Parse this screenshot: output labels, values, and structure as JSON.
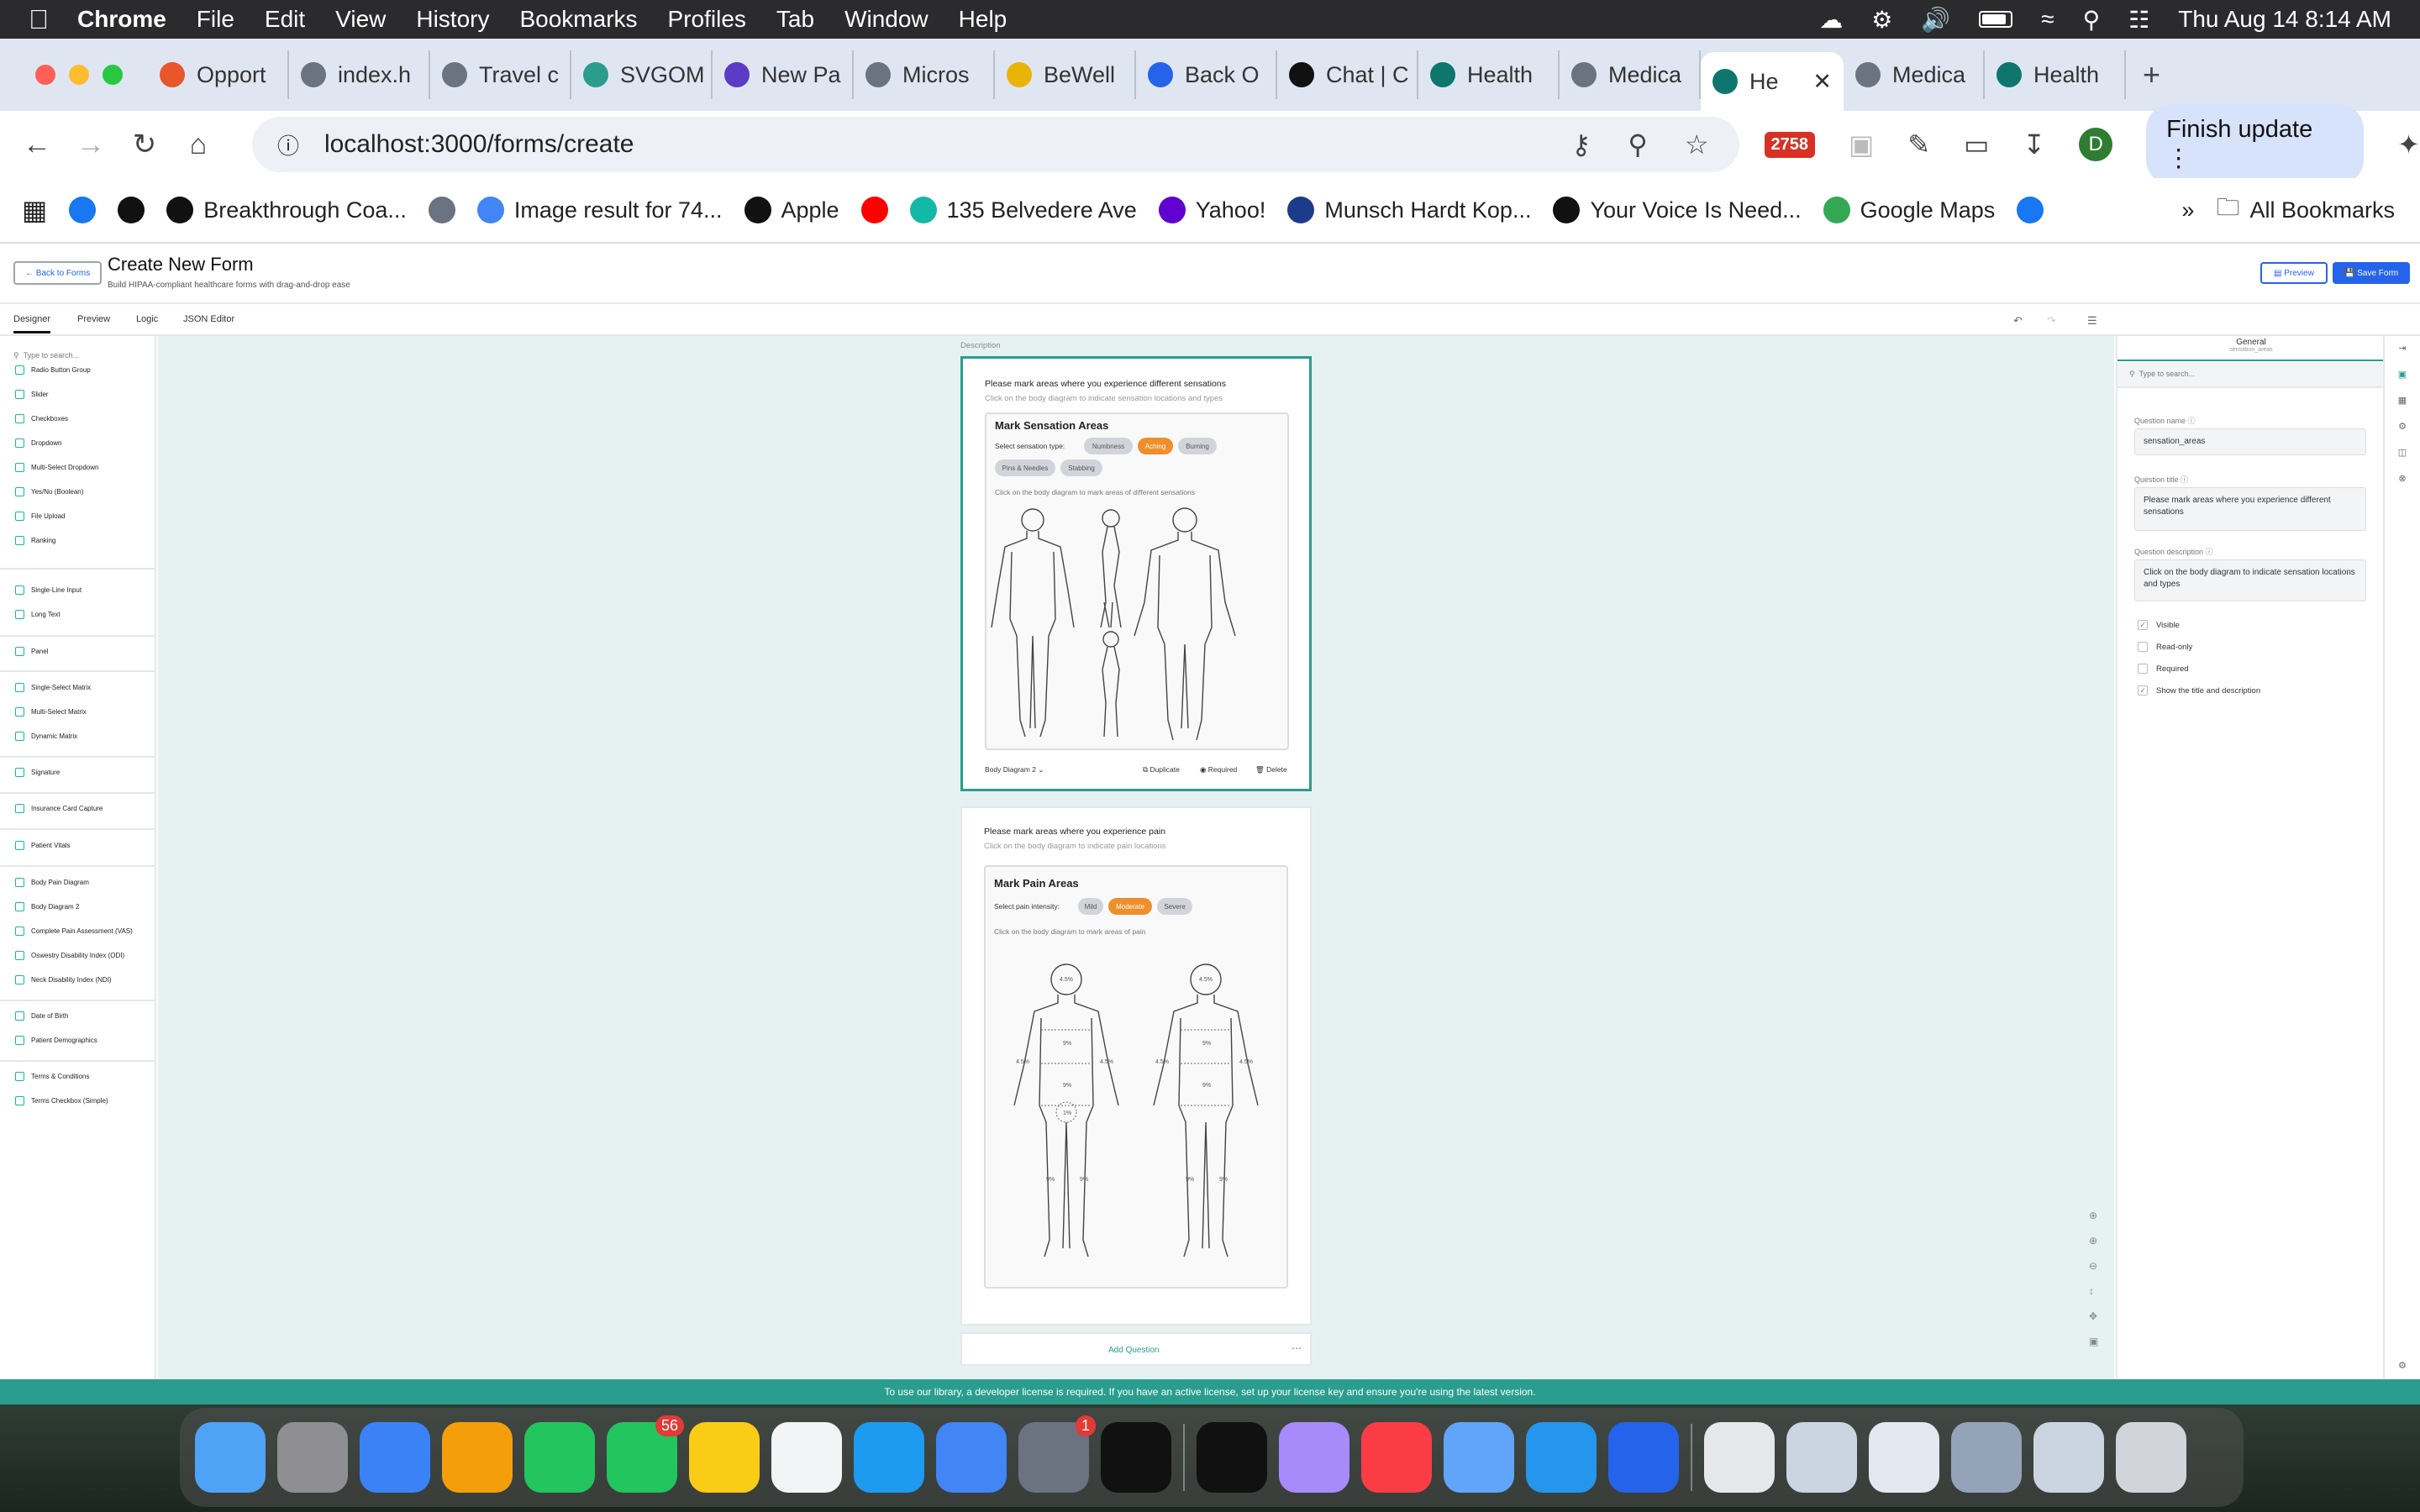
{
  "menubar": {
    "app": "Chrome",
    "items": [
      "File",
      "Edit",
      "View",
      "History",
      "Bookmarks",
      "Profiles",
      "Tab",
      "Window",
      "Help"
    ],
    "datetime": "Thu Aug 14  8:14 AM"
  },
  "tabs": [
    {
      "label": "Opport",
      "color": "#e8562a"
    },
    {
      "label": "index.h",
      "color": "#6b7280"
    },
    {
      "label": "Travel c",
      "color": "#6b7280"
    },
    {
      "label": "SVGOM",
      "color": "#2a9d8f"
    },
    {
      "label": "New Pa",
      "color": "#5b3cc4"
    },
    {
      "label": "Micros",
      "color": "#6b7280"
    },
    {
      "label": "BeWell",
      "color": "#eab308"
    },
    {
      "label": "Back O",
      "color": "#2563eb"
    },
    {
      "label": "Chat | C",
      "color": "#111111"
    },
    {
      "label": "Health",
      "color": "#0f766e"
    },
    {
      "label": "Medica",
      "color": "#6b7280"
    },
    {
      "label": "He",
      "color": "#0f766e",
      "active": true
    },
    {
      "label": "Medica",
      "color": "#6b7280"
    },
    {
      "label": "Health",
      "color": "#0f766e"
    }
  ],
  "toolbar": {
    "url": "localhost:3000/forms/create",
    "badge": "2758",
    "avatar": "D",
    "finish": "Finish update"
  },
  "bookmarks": [
    {
      "label": "",
      "color": "#1877f2"
    },
    {
      "label": "",
      "color": "#111"
    },
    {
      "label": "Breakthrough Coa...",
      "color": "#111"
    },
    {
      "label": "",
      "color": "#6b7280"
    },
    {
      "label": "Image result for 74...",
      "color": "#4285f4"
    },
    {
      "label": "Apple",
      "color": "#111"
    },
    {
      "label": "",
      "color": "#ff0000"
    },
    {
      "label": "135 Belvedere Ave",
      "color": "#14b8a6"
    },
    {
      "label": "Yahoo!",
      "color": "#6001d2"
    },
    {
      "label": "Munsch Hardt Kop...",
      "color": "#1e3a8a"
    },
    {
      "label": "Your Voice Is Need...",
      "color": "#111"
    },
    {
      "label": "Google Maps",
      "color": "#34a853"
    },
    {
      "label": "",
      "color": "#1877f2"
    }
  ],
  "all_bookmarks": "All Bookmarks",
  "app": {
    "back": "Back to Forms",
    "title": "Create New Form",
    "subtitle": "Build HIPAA-compliant healthcare forms with drag-and-drop ease",
    "preview": "Preview",
    "save": "Save Form"
  },
  "designer_tabs": [
    "Designer",
    "Preview",
    "Logic",
    "JSON Editor"
  ],
  "toolbox": {
    "search": "Type to search...",
    "items": [
      "Radio Button Group",
      "Slider",
      "Checkboxes",
      "Dropdown",
      "Multi-Select Dropdown",
      "Yes/No (Boolean)",
      "File Upload",
      "Ranking",
      "Single-Line Input",
      "Long Text",
      "Panel",
      "Single-Select Matrix",
      "Multi-Select Matrix",
      "Dynamic Matrix",
      "Signature",
      "Insurance Card Capture",
      "Patient Vitals",
      "Body Pain Diagram",
      "Body Diagram 2",
      "Complete Pain Assessment (VAS)",
      "Oswestry Disability Index (ODI)",
      "Neck Disability Index (NDI)",
      "Date of Birth",
      "Patient Demographics",
      "Terms & Conditions",
      "Terms Checkbox (Simple)"
    ]
  },
  "canvas": {
    "description": "Description",
    "q1": {
      "title": "Please mark areas where you experience different sensations",
      "desc": "Click on the body diagram to indicate sensation locations and types",
      "heading": "Mark Sensation Areas",
      "select_label": "Select sensation type:",
      "chips": [
        "Numbness",
        "Aching",
        "Burning",
        "Pins & Needles",
        "Stabbing"
      ],
      "active": "Aching",
      "hint": "Click on the body diagram to mark areas of different sensations",
      "footer_type": "Body Diagram 2",
      "duplicate": "Duplicate",
      "required": "Required",
      "delete": "Delete"
    },
    "q2": {
      "title": "Please mark areas where you experience pain",
      "desc": "Click on the body diagram to indicate pain locations",
      "heading": "Mark Pain Areas",
      "select_label": "Select pain intensity:",
      "chips": [
        "Mild",
        "Moderate",
        "Severe"
      ],
      "active": "Moderate",
      "hint": "Click on the body diagram to mark areas of pain",
      "labels": {
        "head": "4.5%",
        "torso": "9%",
        "arm": "4.5%",
        "groin": "1%",
        "leg": "9%"
      }
    },
    "add_question": "Add Question"
  },
  "properties": {
    "tab": "General",
    "sub": "sensation_areas",
    "search": "Type to search...",
    "name_label": "Question name",
    "name": "sensation_areas",
    "title_label": "Question title",
    "title": "Please mark areas where you experience different sensations",
    "desc_label": "Question description",
    "desc": "Click on the body diagram to indicate sensation locations and types",
    "checks": [
      {
        "label": "Visible",
        "on": true
      },
      {
        "label": "Read-only",
        "on": false
      },
      {
        "label": "Required",
        "on": false
      },
      {
        "label": "Show the title and description",
        "on": true
      }
    ]
  },
  "license": "To use our library, a developer license is required. If you have an active license, set up your license key and ensure you're using the latest version.",
  "dock": {
    "messages_badge": "56",
    "settings_badge": "1"
  }
}
